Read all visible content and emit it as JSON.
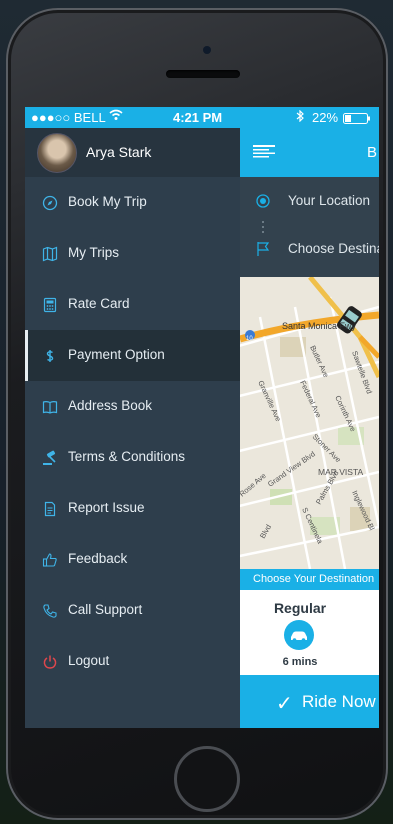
{
  "status": {
    "carrier": "●●●○○ BELL",
    "time": "4:21 PM",
    "battery": "22%"
  },
  "profile": {
    "name": "Arya Stark"
  },
  "menu": {
    "items": [
      {
        "label": "Book My Trip",
        "icon": "compass-icon"
      },
      {
        "label": "My Trips",
        "icon": "map-icon"
      },
      {
        "label": "Rate Card",
        "icon": "calculator-icon"
      },
      {
        "label": "Payment Option",
        "icon": "dollar-icon"
      },
      {
        "label": "Address Book",
        "icon": "book-icon"
      },
      {
        "label": "Terms & Conditions",
        "icon": "gavel-icon"
      },
      {
        "label": "Report Issue",
        "icon": "document-icon"
      },
      {
        "label": "Feedback",
        "icon": "thumbs-up-icon"
      },
      {
        "label": "Call Support",
        "icon": "phone-icon"
      },
      {
        "label": "Logout",
        "icon": "power-icon"
      }
    ],
    "active_index": 3
  },
  "header": {
    "title": "B"
  },
  "location": {
    "from": "Your Location",
    "to": "Choose Destina"
  },
  "map": {
    "labels": [
      "Santa Monica Fwy",
      "Sawtelle Blvd",
      "Butler Ave",
      "Granville Ave",
      "Federal Ave",
      "Corinth Ave",
      "Stoner Ave",
      "Grand View Blvd",
      "MAR VISTA",
      "Palms Blvd",
      "S Centinela",
      "Inglewood Bl",
      "Blvd",
      "Rose Ave",
      "10"
    ]
  },
  "destination_bar": "Choose Your Destination",
  "vehicle": {
    "type": "Regular",
    "eta": "6 mins"
  },
  "ride_button": "Ride Now",
  "colors": {
    "accent": "#1ab0e6",
    "drawer": "#2e3e4c",
    "logout": "#e0474c"
  }
}
